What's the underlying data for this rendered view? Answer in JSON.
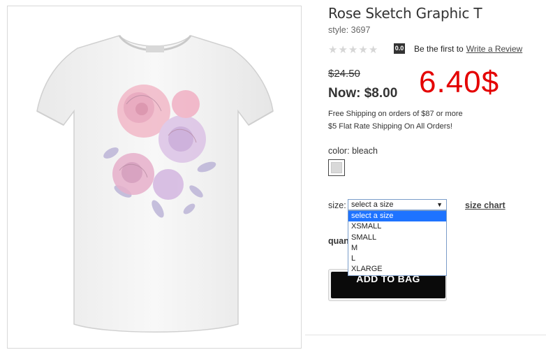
{
  "product": {
    "title": "Rose Sketch Graphic T",
    "style": "style: 3697",
    "image_alt": "white graphic tee with pink and purple rose sketch"
  },
  "rating": {
    "stars_filled": 0,
    "stars_total": 5,
    "score": "0.0",
    "prompt": "Be the first to",
    "link": "Write a Review"
  },
  "pricing": {
    "original": "$24.50",
    "now": "Now: $8.00",
    "annotation": "6.40$",
    "annotation_color": "#e40000"
  },
  "shipping": {
    "line1": "Free Shipping on orders of $87 or more",
    "line2": "$5 Flat Rate Shipping On All Orders!"
  },
  "color": {
    "label": "color:",
    "value": "bleach"
  },
  "size": {
    "label": "size:",
    "selected": "select a size",
    "chart_link": "size chart",
    "options": [
      "select a size",
      "XSMALL",
      "SMALL",
      "M",
      "L",
      "XLARGE"
    ]
  },
  "quantity": {
    "label": "quan"
  },
  "actions": {
    "add_to_bag": "ADD TO BAG"
  }
}
